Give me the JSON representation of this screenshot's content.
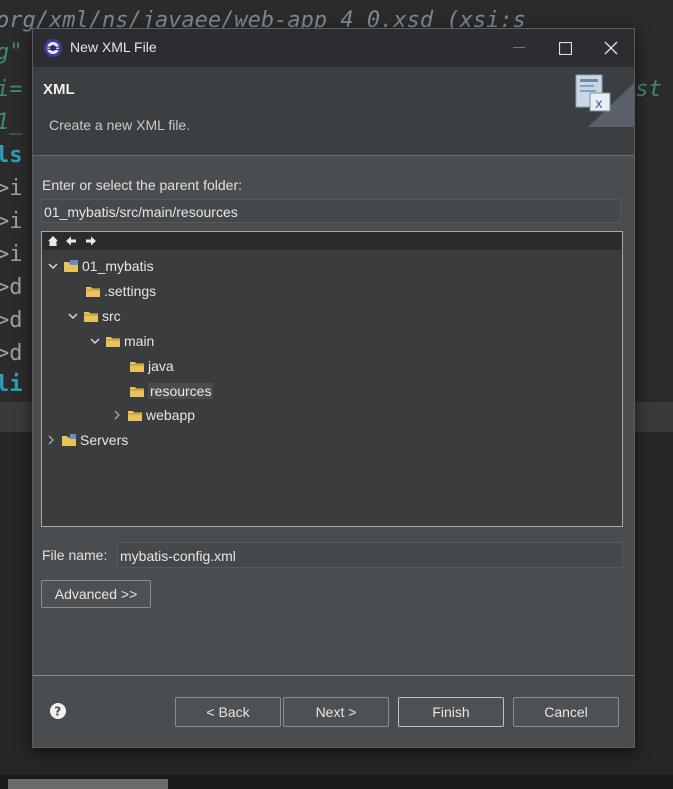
{
  "dialog": {
    "title": "New XML File",
    "header_title": "XML",
    "header_description": "Create a new XML file.",
    "parent_folder_label": "Enter or select the parent folder:",
    "parent_folder_value": "01_mybatis/src/main/resources",
    "file_name_label": "File name:",
    "file_name_value": "mybatis-config.xml",
    "advanced_label": "Advanced >>",
    "buttons": {
      "back": "< Back",
      "next": "Next >",
      "finish": "Finish",
      "cancel": "Cancel"
    }
  },
  "tree": {
    "items": [
      {
        "label": "01_mybatis",
        "depth": 0,
        "expanded": true,
        "icon": "project-icon"
      },
      {
        "label": ".settings",
        "depth": 1,
        "expanded": null,
        "icon": "folder-icon"
      },
      {
        "label": "src",
        "depth": 1,
        "expanded": true,
        "icon": "folder-icon"
      },
      {
        "label": "main",
        "depth": 2,
        "expanded": true,
        "icon": "folder-icon"
      },
      {
        "label": "java",
        "depth": 3,
        "expanded": null,
        "icon": "folder-icon"
      },
      {
        "label": "resources",
        "depth": 3,
        "expanded": null,
        "icon": "folder-icon",
        "selected": true
      },
      {
        "label": "webapp",
        "depth": 3,
        "expanded": false,
        "icon": "folder-icon"
      },
      {
        "label": "Servers",
        "depth": 0,
        "expanded": false,
        "icon": "project-folder-icon"
      }
    ]
  },
  "editor_background": {
    "lines": [
      "org/xml/ns/javaee/web-app_4_0.xsd (xsi:s",
      "g\"",
      "i=",
      "1_",
      "ls",
      ">i",
      ">i",
      ">i",
      ">d",
      ">d",
      ">d",
      "li"
    ],
    "right_fragment": "ast"
  },
  "colors": {
    "dialog_bg": "#4a4d50",
    "titlebar_bg": "#2b2d30",
    "folder": "#e8c25a"
  }
}
